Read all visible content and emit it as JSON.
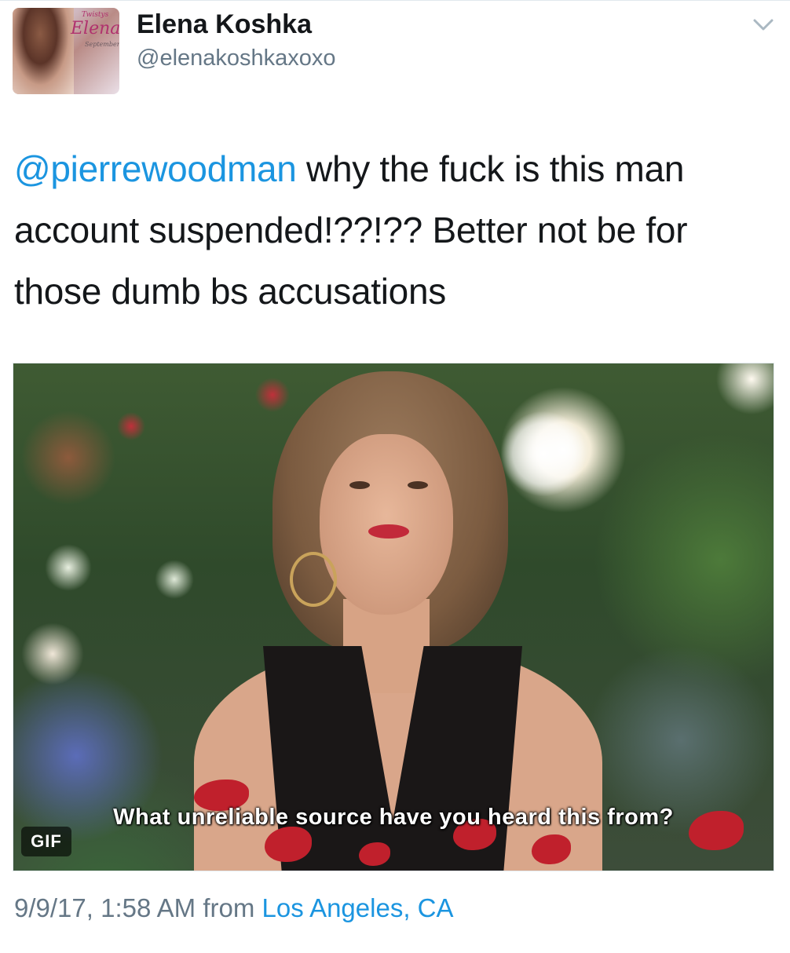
{
  "author": {
    "display_name": "Elena Koshka",
    "handle": "@elenakoshkaxoxo",
    "avatar_text": {
      "brand": "Twistys",
      "name": "Elena",
      "month": "September"
    }
  },
  "tweet": {
    "mention": "@pierrewoodman",
    "text": " why the fuck is this man account suspended!??!?? Better not be for those dumb bs accusations"
  },
  "media": {
    "caption": "What unreliable source have you heard this from?",
    "badge": "GIF"
  },
  "meta": {
    "timestamp": "9/9/17, 1:58 AM",
    "from_label": "from",
    "location": "Los Angeles, CA"
  },
  "colors": {
    "link": "#1b95e0",
    "secondary": "#657786",
    "text": "#14171a"
  },
  "icons": {
    "menu": "chevron-down-icon"
  }
}
